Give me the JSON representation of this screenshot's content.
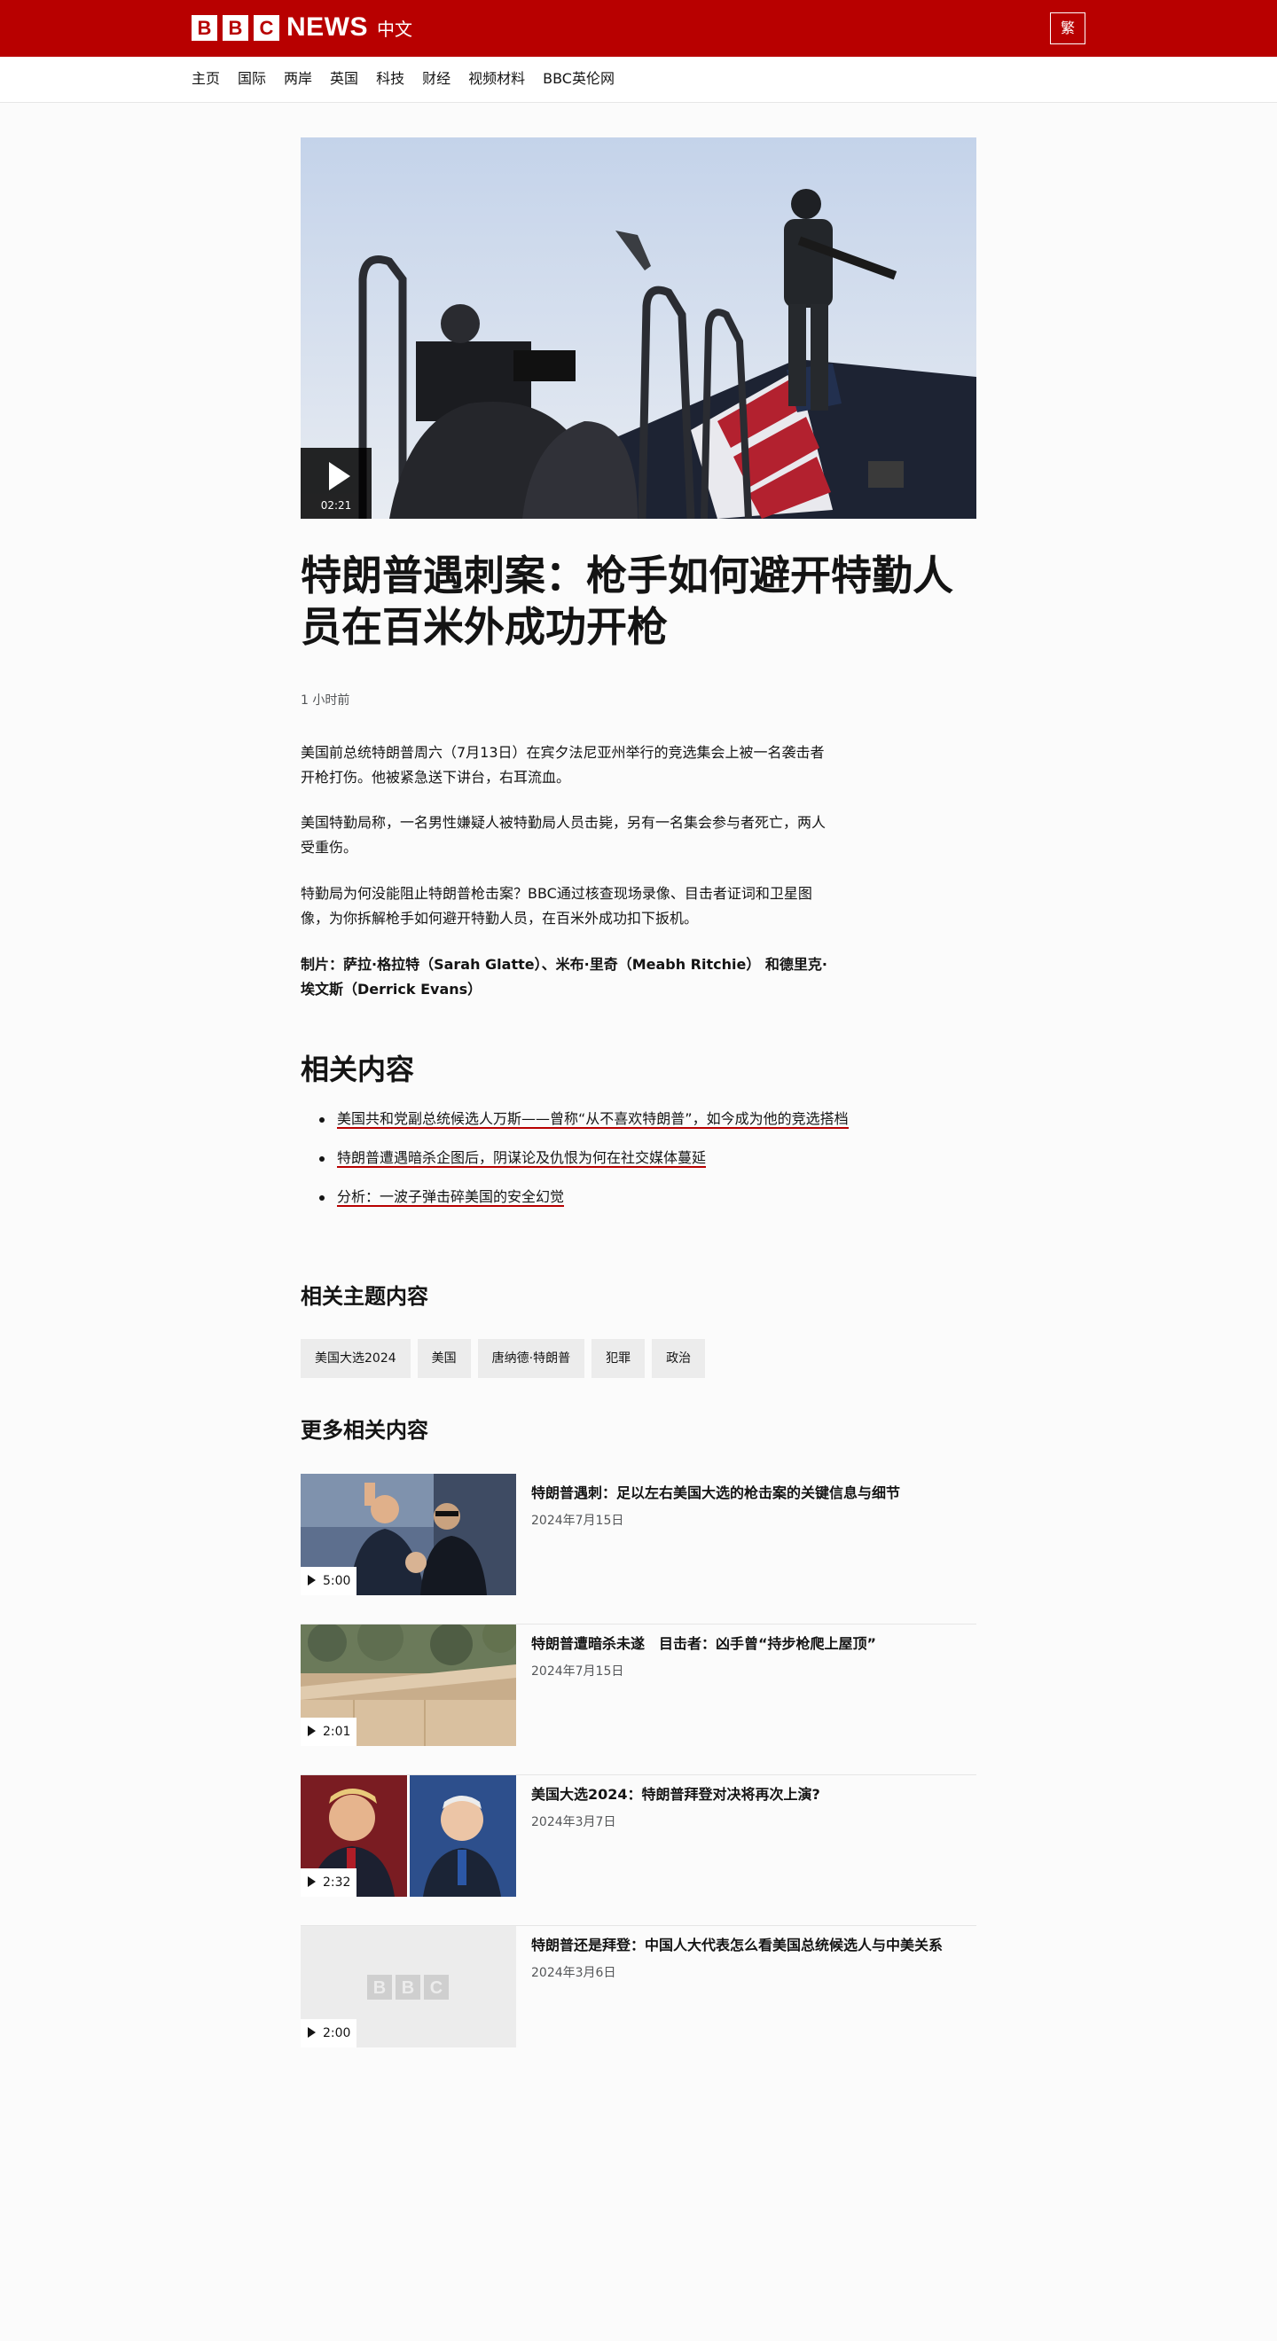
{
  "header": {
    "logo_blocks": [
      "B",
      "B",
      "C"
    ],
    "logo_news": "NEWS",
    "logo_lang": "中文",
    "script_toggle": "繁",
    "brand_color": "#b80000"
  },
  "nav": {
    "items": [
      "主页",
      "国际",
      "两岸",
      "英国",
      "科技",
      "财经",
      "视频材料",
      "BBC英伦网"
    ]
  },
  "article": {
    "video_duration": "02:21",
    "headline": "特朗普遇刺案：枪手如何避开特勤人员在百米外成功开枪",
    "timestamp": "1 小时前",
    "paragraphs": [
      "美国前总统特朗普周六（7月13日）在宾夕法尼亚州举行的竞选集会上被一名袭击者开枪打伤。他被紧急送下讲台，右耳流血。",
      "美国特勤局称，一名男性嫌疑人被特勤局人员击毙，另有一名集会参与者死亡，两人受重伤。",
      "特勤局为何没能阻止特朗普枪击案？BBC通过核查现场录像、目击者证词和卫星图像，为你拆解枪手如何避开特勤人员，在百米外成功扣下扳机。"
    ],
    "credits": "制片：萨拉·格拉特（Sarah Glatte）、米布·里奇（Meabh Ritchie） 和德里克·埃文斯（Derrick Evans）"
  },
  "related": {
    "heading": "相关内容",
    "links": [
      "美国共和党副总统候选人万斯——曾称“从不喜欢特朗普”，如今成为他的竞选搭档",
      "特朗普遭遇暗杀企图后，阴谋论及仇恨为何在社交媒体蔓延",
      "分析：一波子弹击碎美国的安全幻觉"
    ]
  },
  "topics": {
    "heading": "相关主题内容",
    "tags": [
      "美国大选2024",
      "美国",
      "唐纳德·特朗普",
      "犯罪",
      "政治"
    ]
  },
  "more": {
    "heading": "更多相关内容",
    "items": [
      {
        "title": "特朗普遇刺：足以左右美国大选的枪击案的关键信息与细节",
        "date": "2024年7月15日",
        "duration": "5:00",
        "thumb": "trump-raised-fist"
      },
      {
        "title": "特朗普遭暗杀未遂　目击者：凶手曾“持步枪爬上屋顶”",
        "date": "2024年7月15日",
        "duration": "2:01",
        "thumb": "rooftop"
      },
      {
        "title": "美国大选2024：特朗普拜登对决将再次上演?",
        "date": "2024年3月7日",
        "duration": "2:32",
        "thumb": "trump-biden-split"
      },
      {
        "title": "特朗普还是拜登：中国人大代表怎么看美国总统候选人与中美关系",
        "date": "2024年3月6日",
        "duration": "2:00",
        "thumb": "bbc-placeholder"
      }
    ]
  }
}
